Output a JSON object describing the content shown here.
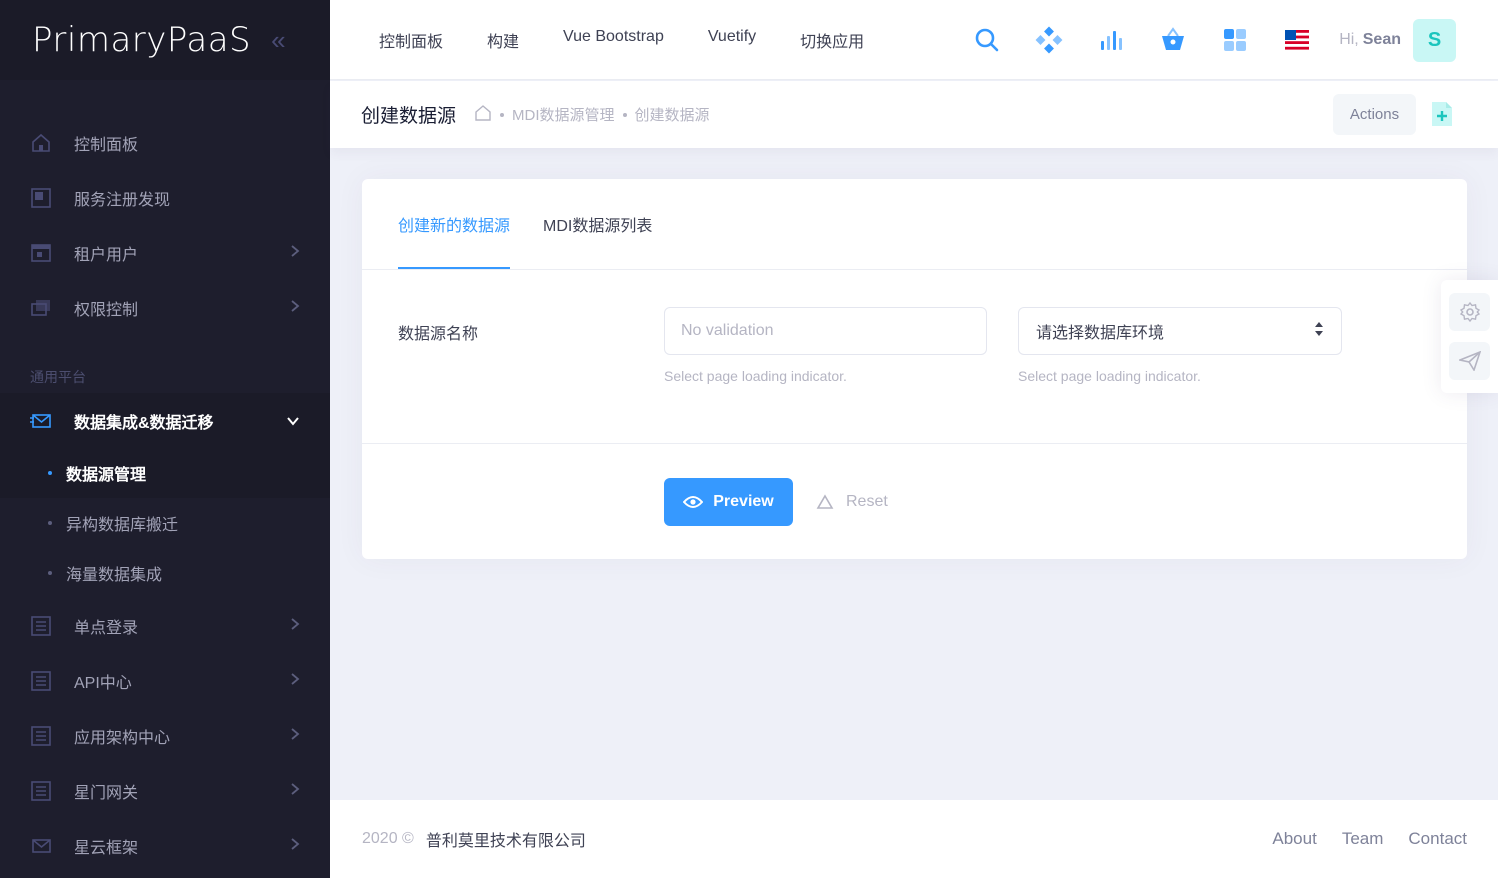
{
  "brand": {
    "name": "PrimaryPaaS",
    "toggle": "«"
  },
  "sidebar": {
    "items": [
      {
        "label": "控制面板",
        "icon": "home-icon"
      },
      {
        "label": "服务注册发现",
        "icon": "layout-icon"
      },
      {
        "label": "租户用户",
        "icon": "browser-icon"
      },
      {
        "label": "权限控制",
        "icon": "layers-icon"
      }
    ],
    "section": "通用平台",
    "open_item": {
      "label": "数据集成&数据迁移",
      "icon": "mail-icon"
    },
    "sub_items": [
      {
        "label": "数据源管理"
      },
      {
        "label": "异构数据库搬迁"
      },
      {
        "label": "海量数据集成"
      }
    ],
    "more_items": [
      {
        "label": "单点登录",
        "icon": "list-icon"
      },
      {
        "label": "API中心",
        "icon": "list-icon"
      },
      {
        "label": "应用架构中心",
        "icon": "list-icon"
      },
      {
        "label": "星门网关",
        "icon": "list-icon"
      },
      {
        "label": "星云框架",
        "icon": "mail-icon"
      }
    ]
  },
  "header": {
    "nav": [
      "控制面板",
      "构建",
      "Vue Bootstrap",
      "Vuetify",
      "切换应用"
    ],
    "greeting": "Hi,",
    "user_name": "Sean",
    "avatar_letter": "S"
  },
  "subheader": {
    "title": "创建数据源",
    "breadcrumb": [
      "MDI数据源管理",
      "创建数据源"
    ],
    "actions_label": "Actions"
  },
  "card": {
    "tabs": [
      "创建新的数据源",
      "MDI数据源列表"
    ],
    "form": {
      "label": "数据源名称",
      "input_placeholder": "No validation",
      "input_hint": "Select page loading indicator.",
      "select_value": "请选择数据库环境",
      "select_hint": "Select page loading indicator."
    },
    "preview_label": "Preview",
    "reset_label": "Reset"
  },
  "footer": {
    "year": "2020 ©",
    "company": "普利莫里技术有限公司",
    "links": [
      "About",
      "Team",
      "Contact"
    ]
  },
  "colors": {
    "primary": "#3699ff",
    "sidebar_bg": "#1e1e2d",
    "success": "#1bc5bd"
  }
}
